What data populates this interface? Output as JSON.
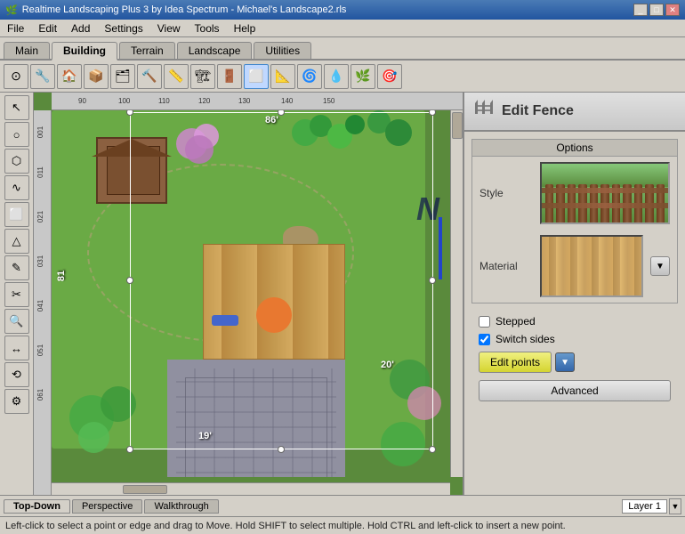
{
  "titlebar": {
    "title": "Realtime Landscaping Plus 3 by Idea Spectrum - Michael's Landscape2.rls",
    "icon": "🌿",
    "controls": [
      "_",
      "□",
      "✕"
    ]
  },
  "menubar": {
    "items": [
      "File",
      "Edit",
      "Add",
      "Settings",
      "View",
      "Tools",
      "Help"
    ]
  },
  "tabs": {
    "items": [
      "Main",
      "Building",
      "Terrain",
      "Landscape",
      "Utilities"
    ],
    "active": "Building"
  },
  "toolbar": {
    "tools": [
      "⊙",
      "🔧",
      "🏠",
      "📦",
      "🗂",
      "🔨",
      "📏",
      "🏗",
      "🚪",
      "🔲",
      "📐",
      "🌀",
      "💧",
      "🌿",
      "🎯"
    ]
  },
  "left_tools": {
    "tools": [
      "↖",
      "○",
      "⬡",
      "∿",
      "⬜",
      "△",
      "✎",
      "✂",
      "🔍",
      "↔",
      "⟲",
      "⚙"
    ]
  },
  "canvas": {
    "ruler_marks_top": [
      "90",
      "100",
      "110",
      "120",
      "130",
      "140",
      "150"
    ],
    "ruler_marks_left": [
      "001",
      "011",
      "021",
      "031",
      "041",
      "051",
      "061"
    ],
    "compass": "N",
    "measures": {
      "top": "86'",
      "left": "81",
      "bottom": "19'",
      "right": "20'"
    }
  },
  "edit_fence_panel": {
    "title": "Edit Fence",
    "icon": "🏗",
    "options_label": "Options",
    "style_label": "Style",
    "material_label": "Material",
    "stepped_label": "Stepped",
    "stepped_checked": false,
    "switch_sides_label": "Switch sides",
    "switch_sides_checked": true,
    "edit_points_label": "Edit points",
    "advanced_label": "Advanced"
  },
  "bottom_tabs": {
    "items": [
      "Top-Down",
      "Perspective",
      "Walkthrough"
    ],
    "active": "Top-Down",
    "layer_label": "Layer 1"
  },
  "statusbar": {
    "text": "Left-click to select a point or edge and drag to Move. Hold SHIFT to select multiple. Hold CTRL and left-click to insert a new point."
  }
}
